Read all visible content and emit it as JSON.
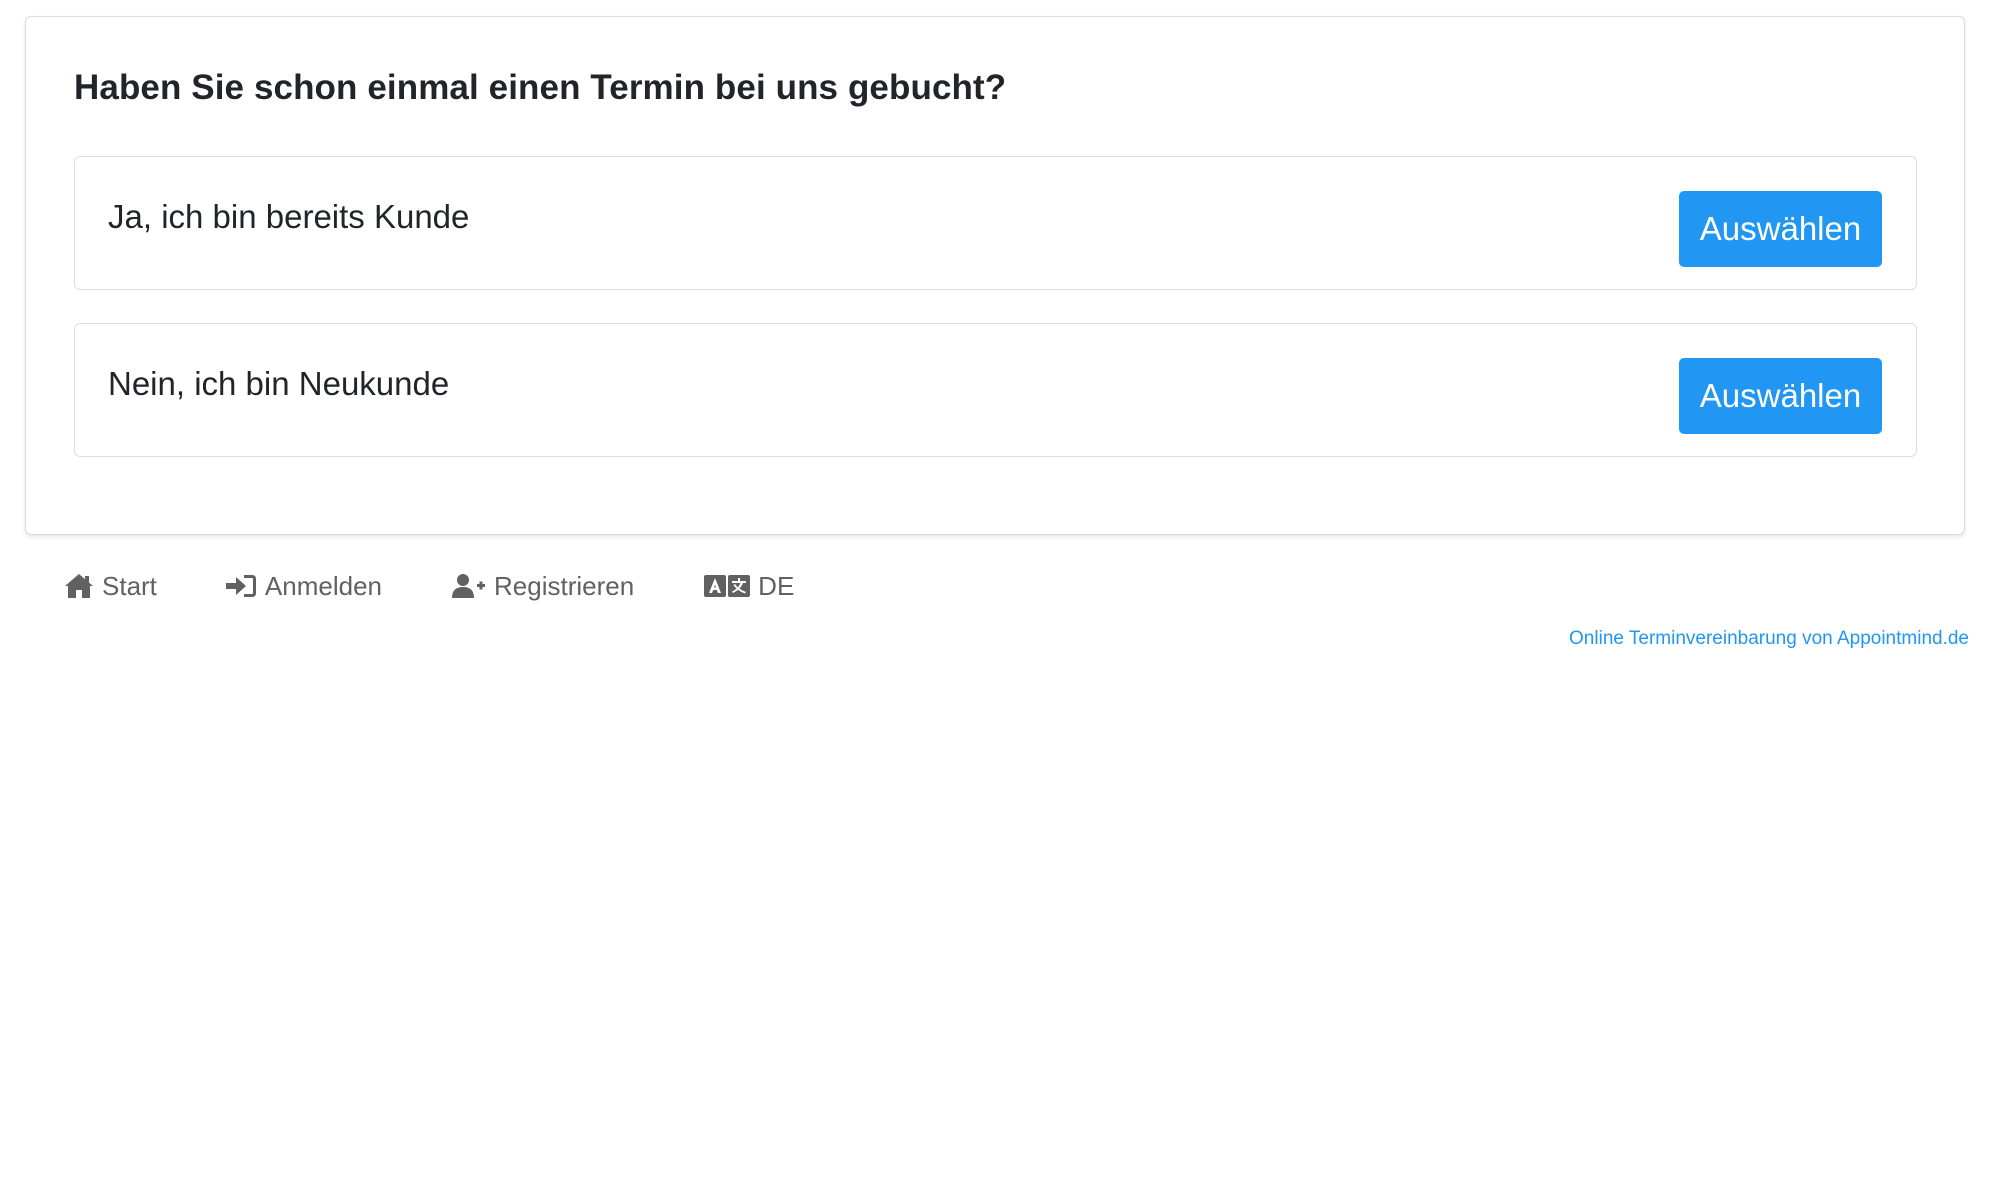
{
  "question": "Haben Sie schon einmal einen Termin bei uns gebucht?",
  "options": [
    {
      "label": "Ja, ich bin bereits Kunde",
      "button": "Auswählen"
    },
    {
      "label": "Nein, ich bin Neukunde",
      "button": "Auswählen"
    }
  ],
  "footer_nav": {
    "start": {
      "label": "Start",
      "icon": "home-icon"
    },
    "login": {
      "label": "Anmelden",
      "icon": "sign-in-icon"
    },
    "register": {
      "label": "Registrieren",
      "icon": "user-plus-icon"
    },
    "language": {
      "label": "DE",
      "icon": "language-icon"
    }
  },
  "credit": "Online Terminvereinbarung von Appointmind.de",
  "colors": {
    "primary": "#2196f3",
    "text": "#212529",
    "muted": "#616161",
    "border": "#dddddd"
  }
}
